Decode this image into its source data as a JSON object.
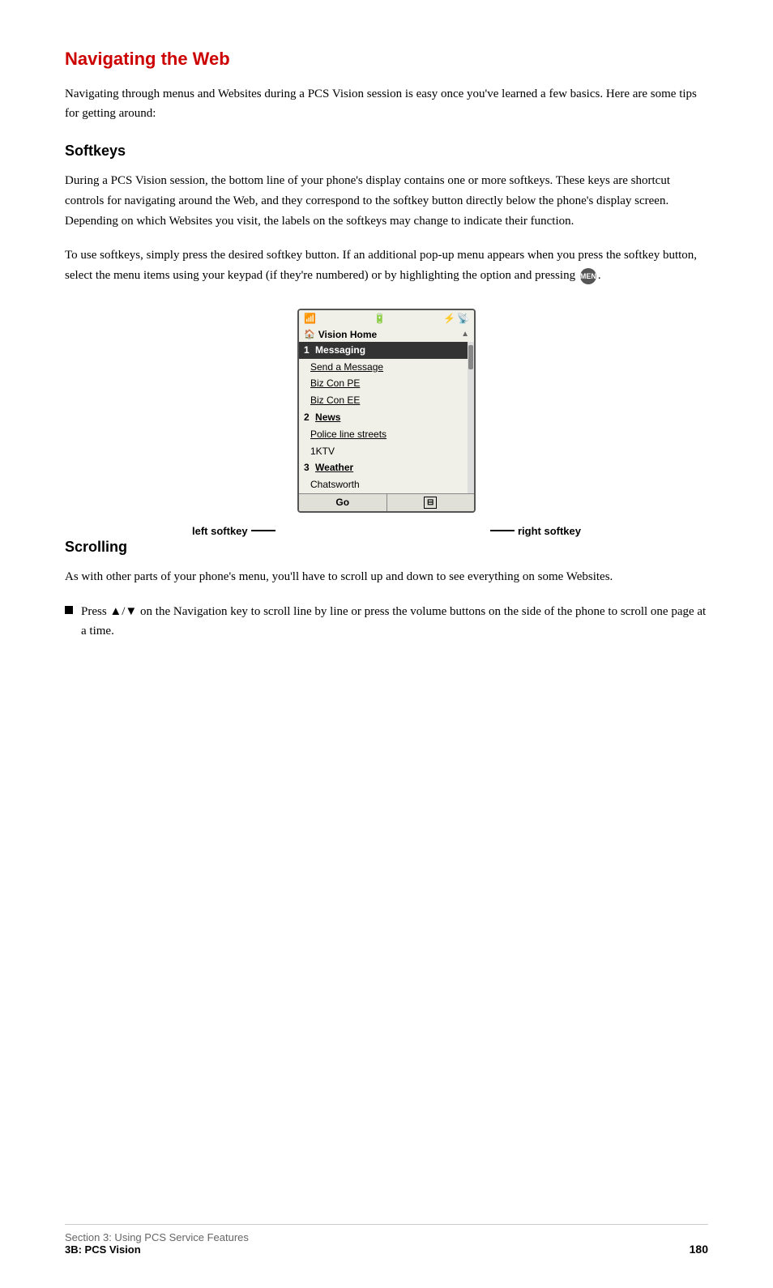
{
  "page": {
    "title": "Navigating the Web",
    "intro": "Navigating through menus and Websites during a PCS Vision session is easy once you've learned a few basics. Here are some tips for getting around:",
    "softkeys_heading": "Softkeys",
    "softkeys_para1": "During a PCS Vision session, the bottom line of your phone's display contains one or more softkeys. These keys are shortcut controls for navigating around the Web, and they correspond to the softkey button directly below the phone's display screen. Depending on which Websites you visit, the labels on the softkeys may change to indicate their function.",
    "softkeys_para2": "To use softkeys, simply press the desired softkey button. If an additional pop-up menu appears when you press the softkey button, select the menu items using your keypad (if they're numbered) or by highlighting the option and pressing",
    "menu_ok_label": "MENU OK",
    "left_softkey_label": "left softkey",
    "right_softkey_label": "right softkey",
    "scrolling_heading": "Scrolling",
    "scrolling_para": "As with other parts of your phone's menu, you'll have to scroll up and down to see everything on some Websites.",
    "scrolling_bullet": "Press ▲/▼ on the Navigation key to scroll line by line or press the volume buttons on the side of the phone to scroll one page at a time.",
    "footer_section": "Section 3: Using PCS Service Features",
    "footer_chapter": "3B: PCS Vision",
    "footer_page": "180"
  },
  "phone_screen": {
    "status_bar": {
      "signal": "📶",
      "center": "🔋",
      "right": "📶"
    },
    "menu_header_icon": "🏠",
    "menu_header_text": "Vision Home",
    "menu_items": [
      {
        "id": 1,
        "number": "1",
        "label": "Messaging",
        "highlighted": true,
        "bold": true
      },
      {
        "text": "Send a Message",
        "underlined": true,
        "indented": true
      },
      {
        "text": "Biz Con PE",
        "underlined": true,
        "indented": true
      },
      {
        "text": "Biz Con EE",
        "underlined": true,
        "indented": true
      },
      {
        "id": 2,
        "number": "2",
        "label": "News",
        "bold": true,
        "underlined_label": true
      },
      {
        "text": "Police line streets",
        "underlined": true,
        "indented": true
      },
      {
        "text": "1KTV",
        "underlined": false,
        "indented": true
      },
      {
        "id": 3,
        "number": "3",
        "label": "Weather",
        "bold": true,
        "underlined_label": true
      },
      {
        "text": "Chatsworth",
        "underlined": false,
        "indented": true
      }
    ],
    "softkey_left": "Go",
    "softkey_right": "⊟"
  }
}
